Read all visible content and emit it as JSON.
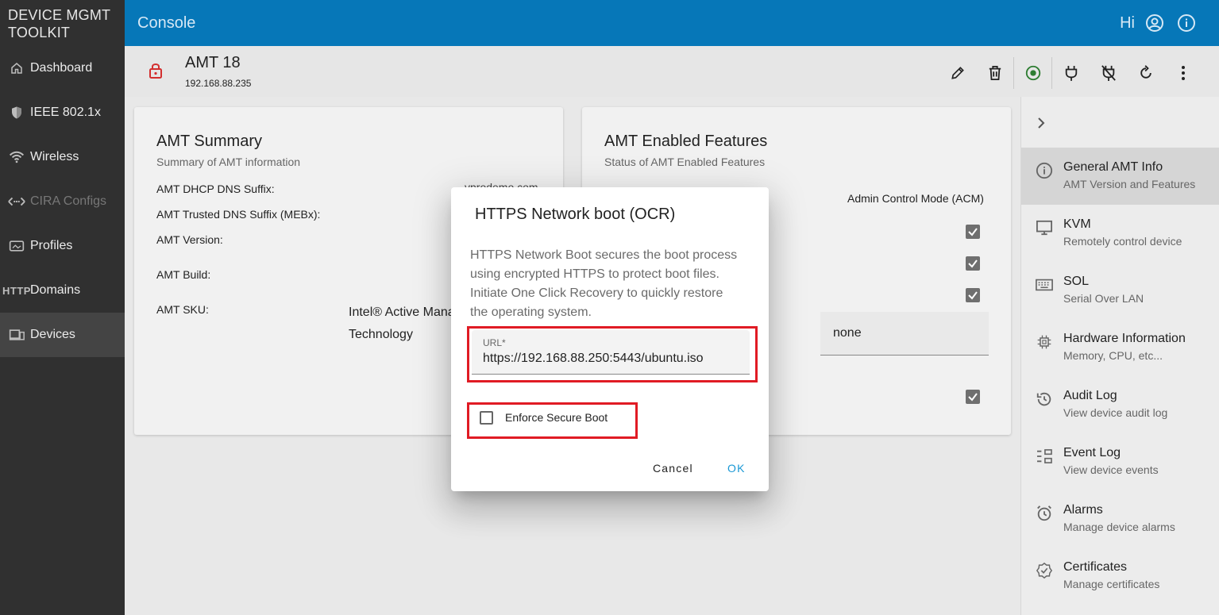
{
  "app": {
    "brand_line1": "DEVICE MGMT",
    "brand_line2": "TOOLKIT",
    "console_title": "Console",
    "greeting": "Hi"
  },
  "sidebar": {
    "items": [
      {
        "label": "Dashboard",
        "icon": "home-icon"
      },
      {
        "label": "IEEE 802.1x",
        "icon": "shield-icon"
      },
      {
        "label": "Wireless",
        "icon": "wifi-icon"
      },
      {
        "label": "CIRA Configs",
        "icon": "arrows-icon"
      },
      {
        "label": "Profiles",
        "icon": "profile-icon"
      },
      {
        "label": "Domains",
        "icon": "http-icon",
        "tag": "HTTP"
      },
      {
        "label": "Devices",
        "icon": "devices-icon"
      }
    ]
  },
  "device": {
    "name": "AMT 18",
    "ip": "192.168.88.235"
  },
  "summary": {
    "title": "AMT Summary",
    "subtitle": "Summary of AMT information",
    "rows": [
      "AMT DHCP DNS Suffix:",
      "AMT Trusted DNS Suffix (MEBx):",
      "AMT Version:",
      "AMT Build:",
      "AMT SKU:"
    ],
    "dhcp_value_partial": "vprodemo.com",
    "sku_value_line1": "Intel® Active Mana",
    "sku_value_line2": "Technology"
  },
  "features": {
    "title": "AMT Enabled Features",
    "subtitle": "Status of AMT Enabled Features",
    "mode": "Admin Control Mode (ACM)",
    "select_value": "none"
  },
  "right_panel": {
    "items": [
      {
        "title": "General AMT Info",
        "sub": "AMT Version and Features"
      },
      {
        "title": "KVM",
        "sub": "Remotely control device"
      },
      {
        "title": "SOL",
        "sub": "Serial Over LAN"
      },
      {
        "title": "Hardware Information",
        "sub": "Memory, CPU, etc..."
      },
      {
        "title": "Audit Log",
        "sub": "View device audit log"
      },
      {
        "title": "Event Log",
        "sub": "View device events"
      },
      {
        "title": "Alarms",
        "sub": "Manage device alarms"
      },
      {
        "title": "Certificates",
        "sub": "Manage certificates"
      }
    ]
  },
  "dialog": {
    "title": "HTTPS Network boot (OCR)",
    "body": "HTTPS Network Boot secures the boot process using encrypted HTTPS to protect boot files. Initiate One Click Recovery to quickly restore the operating system.",
    "url_label": "URL*",
    "url_value": "https://192.168.88.250:5443/ubuntu.iso",
    "checkbox_label": "Enforce Secure Boot",
    "checkbox_checked": false,
    "cancel": "Cancel",
    "ok": "OK"
  },
  "colors": {
    "topbar": "#0677b8",
    "sidebar": "#303030",
    "highlight": "#e01b24",
    "ok_button": "#1a98d5",
    "lock": "#d32f2f",
    "power_on": "#2e7d32"
  }
}
